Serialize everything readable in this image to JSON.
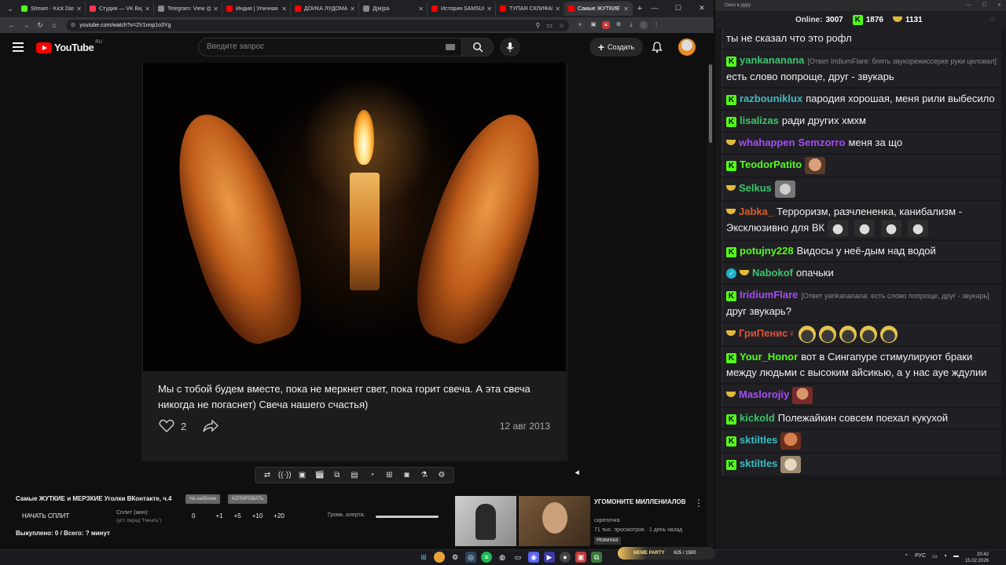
{
  "browser": {
    "tabs": [
      {
        "label": "Stream - Kick Dash",
        "color": "#53fc18",
        "active": false
      },
      {
        "label": "Студия — VK Видео",
        "color": "#ff3347",
        "active": false
      },
      {
        "label": "Telegram: View @",
        "color": "#888888",
        "active": false
      },
      {
        "label": "Индия | Уличная",
        "color": "#ff0000",
        "active": false
      },
      {
        "label": "ДОЙКА ЛУДОМАН",
        "color": "#ff0000",
        "active": false
      },
      {
        "label": "Д[м]ра",
        "color": "#888888",
        "active": false
      },
      {
        "label": "История SAMSUNG",
        "color": "#ff0000",
        "active": false
      },
      {
        "label": "ТУПАЯ СКЛИФАН",
        "color": "#ff0000",
        "active": false
      },
      {
        "label": "Самые ЖУТКИЕ",
        "color": "#ff0000",
        "active": true
      }
    ],
    "url": "youtube.com/watch?v=2V1nnp1o3Yg"
  },
  "youtube": {
    "logo_text": "YouTube",
    "region": "RU",
    "search_placeholder": "Введите запрос",
    "create_label": "Создать"
  },
  "post": {
    "text": "Мы с тобой будем вместе, пока не меркнет свет, пока горит свеча. А эта свеча никогда не погаснет) Свеча нашего счастья)",
    "likes": "2",
    "date": "12 авг 2013"
  },
  "split_panel": {
    "title": "Самые ЖУТКИЕ и МЕРЗКИЕ Уголки ВКонтакте, ч.4",
    "badge_1": "На шаблоне",
    "badge_2": "КОПИРОВАТЬ",
    "start_label": "НАЧАТЬ СПЛИТ",
    "split_label": "Сплит (мин):",
    "split_sub": "(уст. перед \"Начать\")",
    "values": [
      "0",
      "+1",
      "+5",
      "+10",
      "+20"
    ],
    "volume_label": "Громк. алерта:",
    "status": "Выкуплено: 0 / Всего: ? минут"
  },
  "recommended": {
    "title": "УГОМОНИТЕ МИЛЛЕНИАЛОВ",
    "channel": "скрепочка",
    "meta": "71 тыс. просмотров · 1 день назад",
    "badge": "Новинка"
  },
  "chat": {
    "window_title": "Окно в дуру",
    "online_label": "Online:",
    "online_count": "3007",
    "kick_count": "1876",
    "vk_count": "1131",
    "messages": [
      {
        "platform": "none",
        "user": "",
        "color": "#ffffff",
        "reply": "",
        "text": "ты не сказал что это рофл",
        "emotes": []
      },
      {
        "platform": "kick",
        "user": "yankananana",
        "color": "#3cc46b",
        "reply": "[Ответ IridiumFlare: блять звукорежиссерке руки целовал]",
        "text": "есть слово попроще, друг - звукарь",
        "emotes": []
      },
      {
        "platform": "kick",
        "user": "razbouniklux",
        "color": "#3fbcc2",
        "reply": "",
        "text": "пародия хорошая, меня рили выбесило",
        "emotes": []
      },
      {
        "platform": "kick",
        "user": "lisalizas",
        "color": "#3cc46b",
        "reply": "",
        "text": "ради других хмхм",
        "emotes": []
      },
      {
        "platform": "vk",
        "user": "whahappen",
        "color": "#a64bf4",
        "reply": "",
        "text": "Semzorro меня за що",
        "mention": "Semzorro",
        "emotes": []
      },
      {
        "platform": "kick",
        "user": "TeodorPatito",
        "color": "#53fc18",
        "reply": "",
        "text": "",
        "emotes": [
          "face"
        ]
      },
      {
        "platform": "vk",
        "user": "Selkus",
        "color": "#3cc46b",
        "reply": "",
        "text": "",
        "emotes": [
          "cat"
        ]
      },
      {
        "platform": "vk",
        "user": "Jabka_",
        "color": "#d35f2c",
        "reply": "",
        "text": "Терроризм, разчлененка, канибализм - Эксклюзивно для ВК",
        "emotes": [
          "pepe",
          "pepe",
          "pepe",
          "pepe"
        ]
      },
      {
        "platform": "kick",
        "user": "potujny228",
        "color": "#53fc18",
        "reply": "",
        "text": "Видосы у неё-дым над водой",
        "emotes": []
      },
      {
        "platform": "vk",
        "user": "Nabokof",
        "color": "#3cc46b",
        "reply": "",
        "text": "опачьки",
        "verified": true,
        "emotes": []
      },
      {
        "platform": "kick",
        "user": "IridiumFlare",
        "color": "#a64bf4",
        "reply": "[Ответ yankananana: есть слово попроще, друг - звукарь]",
        "text": "друг звукарь?",
        "emotes": []
      },
      {
        "platform": "vk",
        "user": "ГриПенис♀",
        "color": "#e0533a",
        "reply": "",
        "text": "",
        "emotes": [
          "ball",
          "ball",
          "ball",
          "ball",
          "ball"
        ]
      },
      {
        "platform": "kick",
        "user": "Your_Honor",
        "color": "#53fc18",
        "reply": "",
        "text": "вот в Сингапуре стимулируют браки между людьми с высоким айсикью, а у нас ауе ждулии",
        "emotes": []
      },
      {
        "platform": "vk",
        "user": "Maslorojiy",
        "color": "#a64bf4",
        "reply": "",
        "text": "",
        "emotes": [
          "man"
        ]
      },
      {
        "platform": "kick",
        "user": "kickold",
        "color": "#3cc46b",
        "reply": "",
        "text": "Полежайкин совсем поехал кукухой",
        "emotes": []
      },
      {
        "platform": "kick",
        "user": "sktiltles",
        "color": "#3fbcc2",
        "reply": "",
        "text": "",
        "emotes": [
          "beard"
        ]
      },
      {
        "platform": "kick",
        "user": "sktiltles",
        "color": "#3fbcc2",
        "reply": "",
        "text": "",
        "emotes": [
          "meme"
        ]
      }
    ]
  },
  "taskbar": {
    "widget_title": "MEME PARTY",
    "widget_value": "625 / 1500",
    "lang": "РУС",
    "time": "20:42",
    "date": "15.02.2026"
  }
}
